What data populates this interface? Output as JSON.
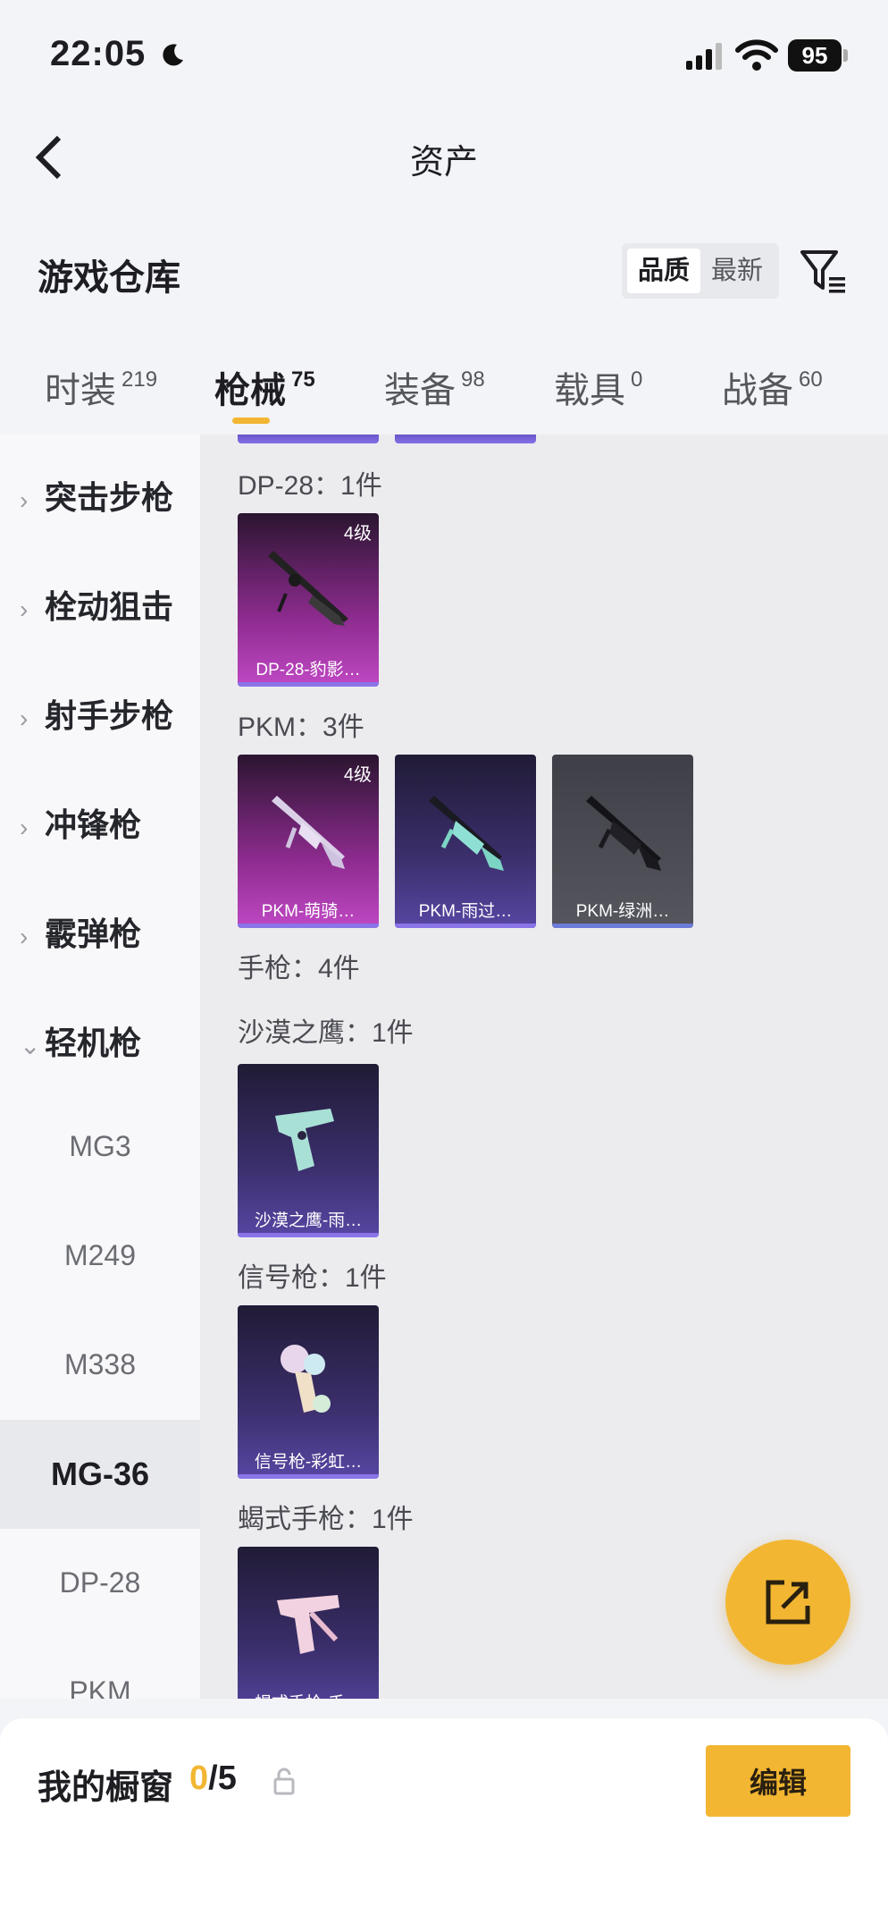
{
  "status": {
    "time": "22:05",
    "battery": "95"
  },
  "header": {
    "title": "资产"
  },
  "section": {
    "title": "游戏仓库",
    "sort": [
      "品质",
      "最新"
    ]
  },
  "tabs": [
    {
      "label": "时装",
      "count": "219"
    },
    {
      "label": "枪械",
      "count": "75"
    },
    {
      "label": "装备",
      "count": "98"
    },
    {
      "label": "载具",
      "count": "0"
    },
    {
      "label": "战备",
      "count": "60"
    }
  ],
  "sidebar": {
    "categories": [
      "突击步枪",
      "栓动狙击",
      "射手步枪",
      "冲锋枪",
      "霰弹枪",
      "轻机枪"
    ],
    "subitems": [
      "MG3",
      "M249",
      "M338",
      "MG-36",
      "DP-28",
      "PKM"
    ],
    "active_subitem": "MG-36"
  },
  "content": {
    "groups": [
      {
        "label": "DP-28：1件",
        "cards": [
          {
            "level": "4级",
            "name": "DP-28-豹影…",
            "style": "pink"
          }
        ]
      },
      {
        "label": "PKM：3件",
        "cards": [
          {
            "level": "4级",
            "name": "PKM-萌骑…",
            "style": "pink"
          },
          {
            "level": "",
            "name": "PKM-雨过…",
            "style": "purple"
          },
          {
            "level": "",
            "name": "PKM-绿洲…",
            "style": "grey"
          }
        ]
      },
      {
        "label": "手枪：4件"
      },
      {
        "label": "沙漠之鹰：1件",
        "cards": [
          {
            "level": "",
            "name": "沙漠之鹰-雨…",
            "style": "purple"
          }
        ]
      },
      {
        "label": "信号枪：1件",
        "cards": [
          {
            "level": "",
            "name": "信号枪-彩虹…",
            "style": "purple"
          }
        ]
      },
      {
        "label": "蝎式手枪：1件",
        "cards": [
          {
            "level": "",
            "name": "蝎式手枪-千…",
            "style": "purple"
          }
        ]
      }
    ]
  },
  "showcase": {
    "label": "我的橱窗",
    "current": "0",
    "total": "/5",
    "edit_label": "编辑"
  },
  "colors": {
    "accent": "#f2b632",
    "pink_card": "#c048c4",
    "purple_card": "#5846a3"
  }
}
